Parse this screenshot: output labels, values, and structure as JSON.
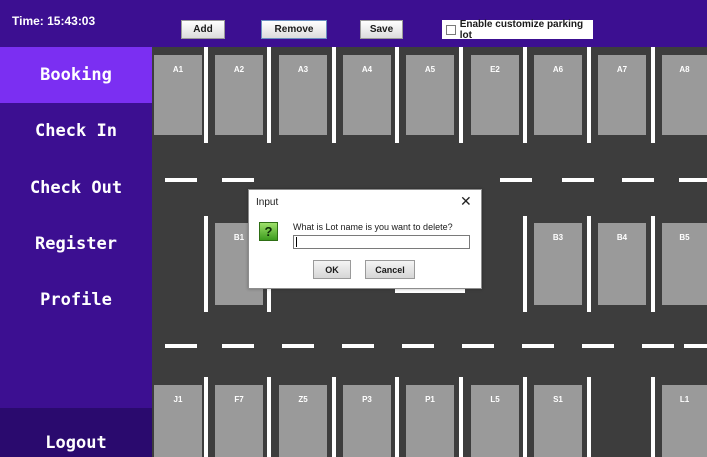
{
  "header": {
    "time_label": "Time: 15:43:03",
    "buttons": {
      "add": "Add",
      "remove": "Remove",
      "save": "Save"
    },
    "customize_checkbox": {
      "label": "Enable customize parking lot",
      "checked": false
    }
  },
  "sidebar": {
    "items": [
      {
        "label": "Booking",
        "active": true
      },
      {
        "label": "Check In"
      },
      {
        "label": "Check Out"
      },
      {
        "label": "Register"
      },
      {
        "label": "Profile"
      }
    ],
    "logout_label": "Logout"
  },
  "parking": {
    "top_row": [
      "A1",
      "A2",
      "A3",
      "A4",
      "A5",
      "E2",
      "A6",
      "A7",
      "A8"
    ],
    "middle_row": [
      "B1",
      "B3",
      "B4",
      "B5"
    ],
    "bottom_row": [
      "J1",
      "F7",
      "Z5",
      "P3",
      "P1",
      "L5",
      "S1",
      "L1"
    ]
  },
  "dialog": {
    "title": "Input",
    "close_glyph": "✕",
    "icon_glyph": "?",
    "message": "What is Lot name is you want to delete?",
    "input_value": "",
    "ok_label": "OK",
    "cancel_label": "Cancel"
  },
  "colors": {
    "header_bg": "#3c0f91",
    "sidebar_active": "#7b2ff2",
    "logout_bg": "#2a0a6e",
    "lot_bg": "#3d3d3d",
    "spot": "#9a9a9a"
  }
}
